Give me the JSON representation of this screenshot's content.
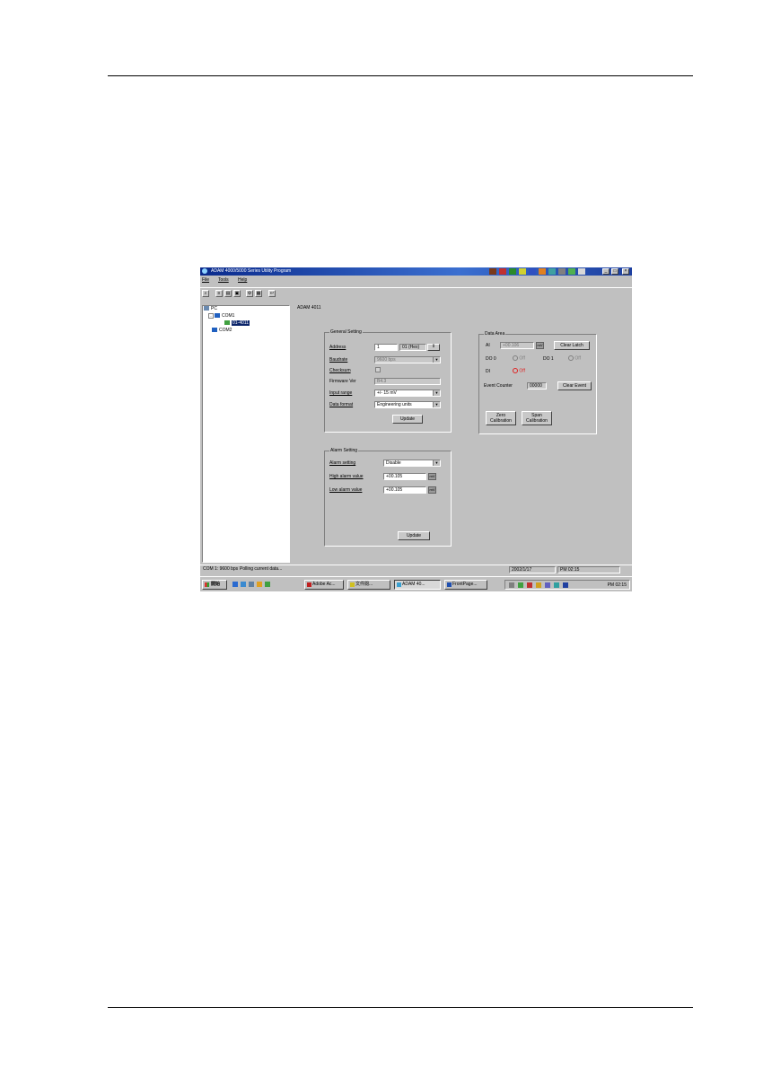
{
  "window": {
    "title": "ADAM 4000/5000 Series Utility Program",
    "menus": [
      "File",
      "Tools",
      "Help"
    ],
    "tray_icons": [
      "tray-app-icon-1",
      "tray-app-icon-2",
      "tray-app-icon-3",
      "tray-app-icon-4",
      "tray-app-icon-5",
      "tray-app-icon-6",
      "tray-app-icon-7",
      "tray-app-icon-8"
    ],
    "controls": {
      "minimize": "_",
      "maximize": "□",
      "close": "×"
    }
  },
  "toolbar": {
    "buttons": [
      "search-icon",
      "list-icon",
      "terminal-icon",
      "save-icon",
      "settings-icon",
      "module-icon",
      "exit-icon"
    ]
  },
  "tree": {
    "root": "PC",
    "com1": "COM1",
    "module": "01-4011",
    "com2": "COM2"
  },
  "module_name": "ADAM 4011",
  "general": {
    "heading": "General Setting",
    "address_label": "Address",
    "address_value": "1",
    "address_hex": "01 (Hex)",
    "baudrate_label": "Baudrate",
    "baudrate_value": "9600 bps",
    "checksum_label": "Checksum",
    "checksum_value": "",
    "firmware_label": "Firmware Ver",
    "firmware_value": "B4.3",
    "input_range_label": "Input range",
    "input_range_value": "+/-    15 mV",
    "data_format_label": "Data format",
    "data_format_value": "Engineering units",
    "update_button": "Update"
  },
  "alarm": {
    "heading": "Alarm Setting",
    "alarm_setting_label": "Alarm setting",
    "alarm_setting_value": "Disable",
    "high_label": "High alarm value",
    "high_value": "+00.105",
    "low_label": "Low alarm value",
    "low_value": "+00.105",
    "unit": "mV",
    "update_button": "Update"
  },
  "data_area": {
    "heading": "Data Area",
    "ai_label": "AI",
    "ai_value": "+00.106",
    "ai_unit": "mV",
    "clear_latch_button": "Clear Latch",
    "do0_label": "DO 0",
    "do0_state": "Off",
    "do1_label": "DO 1",
    "do1_state": "Off",
    "di_label": "DI",
    "di_state": "Off",
    "event_label": "Event Counter",
    "event_value": "00000",
    "clear_event_button": "Clear Event",
    "zero_cal_button": "Zero Calibration",
    "span_cal_button": "Span Calibration"
  },
  "status": {
    "port": "COM 1: 9600 bps",
    "message": "Polling current data...",
    "date": "2002/1/17",
    "time": "PM 02:15"
  },
  "taskbar": {
    "start": "開始",
    "quick_launch": [
      "ie-icon",
      "outlook-icon",
      "desktop-icon",
      "media-icon",
      "paint-icon"
    ],
    "tasks": [
      "Adobe Ac...",
      "文件閱...",
      "ADAM 40...",
      "FrontPage..."
    ],
    "active_task": 2,
    "clock": "PM 02:15",
    "tray": [
      "volume-icon",
      "network-icon",
      "antivirus-icon",
      "ime-icon",
      "printer-icon",
      "messenger-icon",
      "security-icon"
    ]
  },
  "colors": {
    "titlebar": "#0a246a",
    "window_bg": "#c0c0c0",
    "selection": "#0a246a",
    "led_red": "#e02020"
  }
}
